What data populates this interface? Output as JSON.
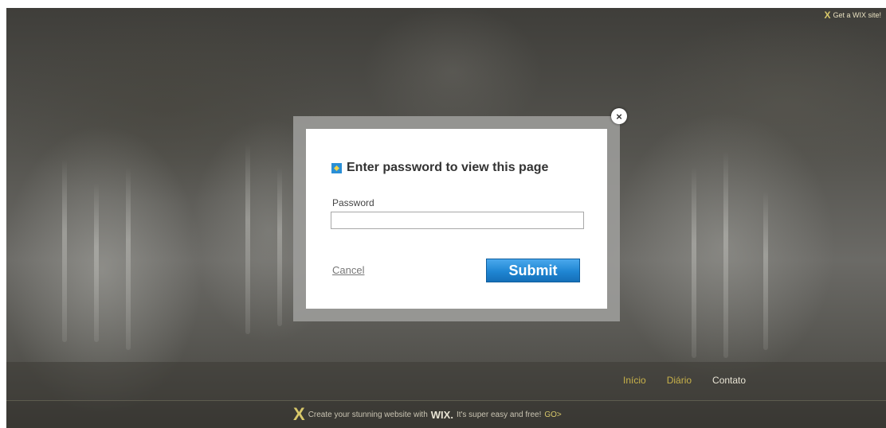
{
  "top_bar": {
    "wix_link_label": "Get a WIX site!",
    "wix_icon": "wix-x-icon"
  },
  "navigation": {
    "items": [
      {
        "label": "Início",
        "state": "active"
      },
      {
        "label": "Diário",
        "state": "active"
      },
      {
        "label": "Contato",
        "state": "normal"
      }
    ]
  },
  "promo": {
    "prefix": "Create your stunning website with",
    "brand": "WIX.",
    "suffix": "It's super easy and free!",
    "go_label": "GO>",
    "icon": "wix-x-icon"
  },
  "modal": {
    "title": "Enter password to view this page",
    "title_icon": "lock-icon",
    "close_icon": "close-icon",
    "close_glyph": "×",
    "password_label": "Password",
    "password_value": "",
    "cancel_label": "Cancel",
    "submit_label": "Submit"
  },
  "colors": {
    "submit_blue": "#1f86d3",
    "nav_active": "#c8b24a",
    "nav_normal": "#e8e4d4",
    "wix_gold": "#d8c86a"
  }
}
